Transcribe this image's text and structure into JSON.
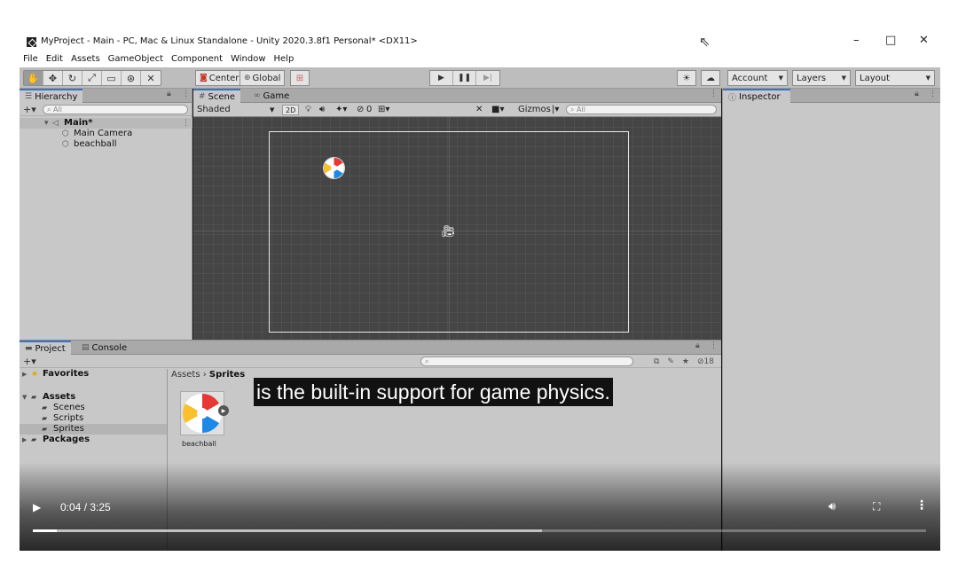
{
  "window": {
    "title": "MyProject - Main - PC, Mac & Linux Standalone - Unity 2020.3.8f1 Personal* <DX11>",
    "controls": {
      "minimize": "–",
      "maximize": "□",
      "close": "✕"
    }
  },
  "menu": [
    "File",
    "Edit",
    "Assets",
    "GameObject",
    "Component",
    "Window",
    "Help"
  ],
  "toolbar": {
    "tools": [
      "hand-icon",
      "move-icon",
      "rotate-icon",
      "scale-icon",
      "rect-icon",
      "transform-icon",
      "custom-tool-icon"
    ],
    "pivot_label": "Center",
    "space_label": "Global",
    "account_label": "Account",
    "layers_label": "Layers",
    "layout_label": "Layout"
  },
  "hierarchy": {
    "tab_label": "Hierarchy",
    "search_placeholder": "All",
    "scene_name": "Main*",
    "objects": [
      "Main Camera",
      "beachball"
    ]
  },
  "scene_view": {
    "tabs": [
      "Scene",
      "Game"
    ],
    "shading": "Shaded",
    "mode_2d": "2D",
    "hidden_count": "0",
    "gizmos_label": "Gizmos",
    "search_placeholder": "All"
  },
  "inspector": {
    "tab_label": "Inspector"
  },
  "project": {
    "tabs": [
      "Project",
      "Console"
    ],
    "favorites_label": "Favorites",
    "assets_label": "Assets",
    "folders": [
      "Scenes",
      "Scripts",
      "Sprites"
    ],
    "packages_label": "Packages",
    "breadcrumb_root": "Assets",
    "breadcrumb_current": "Sprites",
    "asset_name": "beachball",
    "hidden_count": "18"
  },
  "video": {
    "subtitle": "is the built-in support for game physics.",
    "time": "0:04 / 3:25",
    "progress": 0.027,
    "buffered": 0.57
  }
}
